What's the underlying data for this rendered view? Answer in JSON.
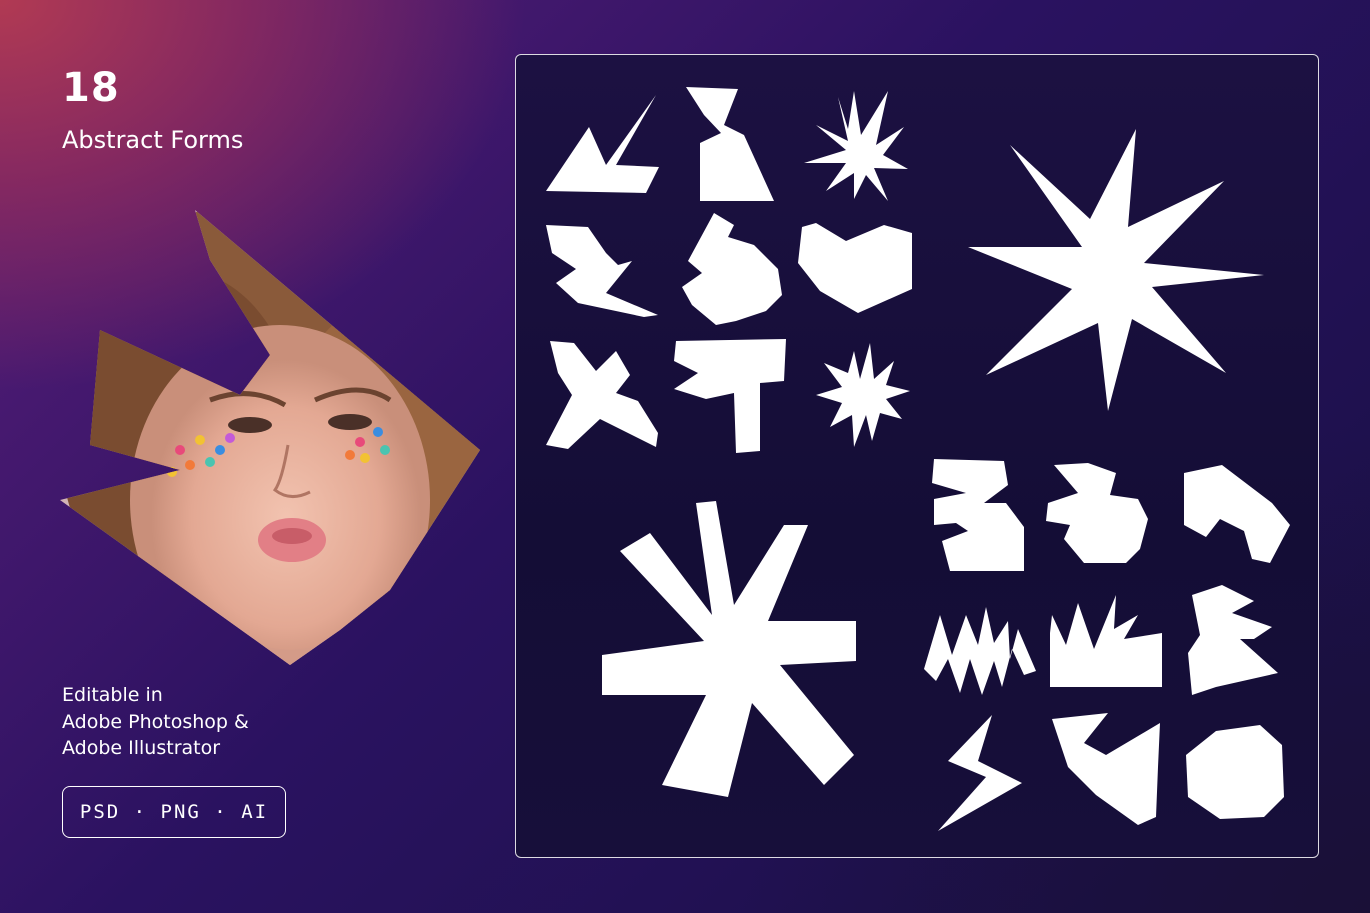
{
  "header": {
    "count": "18",
    "title": "Abstract Forms"
  },
  "info": {
    "editable_lines": [
      "Editable in",
      "Adobe Photoshop &",
      "Adobe Illustrator"
    ]
  },
  "formats": {
    "label": "PSD · PNG · AI"
  },
  "colors": {
    "shape_fill": "#ffffff",
    "panel_background": "#170f3a",
    "accent_top_left": "#b13a53"
  }
}
